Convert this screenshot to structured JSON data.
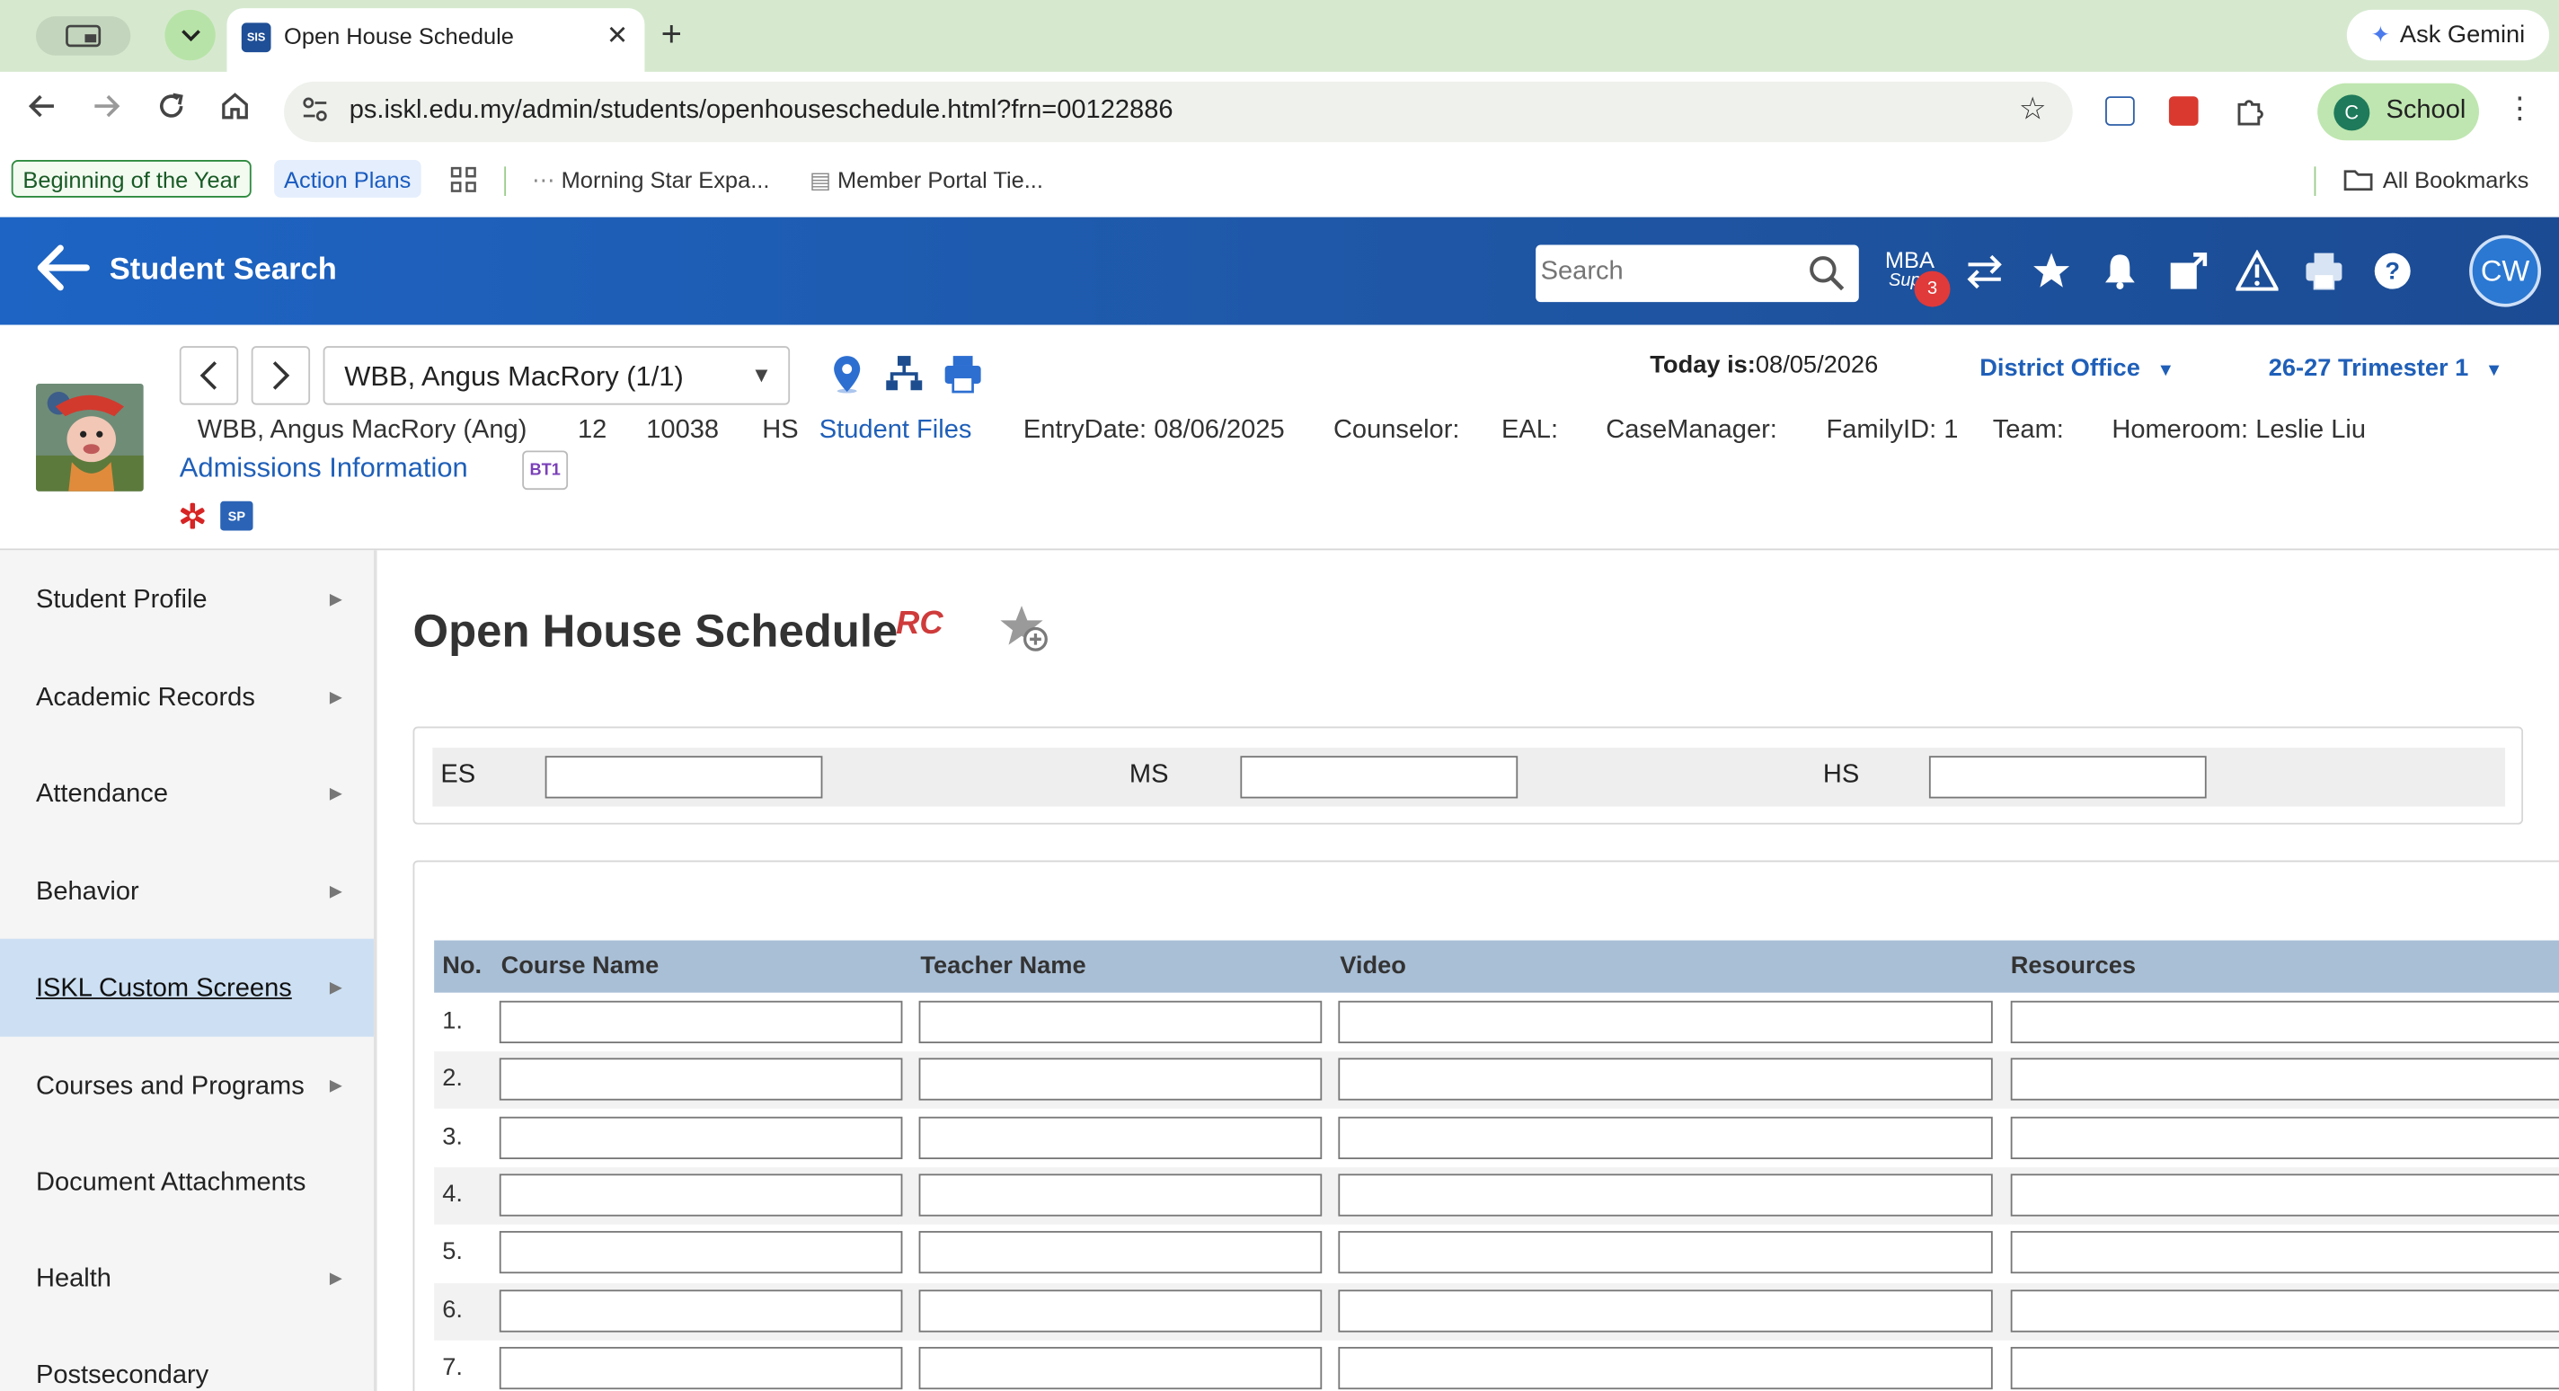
{
  "browser": {
    "tab_title": "Open House Schedule",
    "tab_favicon": "SIS",
    "ask_gemini": "Ask Gemini",
    "url": "ps.iskl.edu.my/admin/students/openhouseschedule.html?frn=00122886",
    "profile_initial": "C",
    "profile_name": "School",
    "bookmarks": [
      "Beginning of the Year",
      "Action Plans",
      "Morning Star Expa...",
      "Member Portal Tie..."
    ],
    "all_bookmarks": "All Bookmarks"
  },
  "header": {
    "back_label": "Student Search",
    "search_placeholder": "Search",
    "mba_line1": "MBA",
    "mba_line2": "Supp",
    "mba_badge": "3",
    "user_initials": "CW"
  },
  "student": {
    "selector": "WBB, Angus MacRory  (1/1)",
    "today_label": "Today is:",
    "today_value": "08/05/2026",
    "district": "District Office",
    "term": "26-27 Trimester 1",
    "name": "WBB, Angus MacRory (Ang)",
    "grade": "12",
    "id": "10038",
    "school": "HS",
    "files_link": "Student Files",
    "entry_date": "EntryDate: 08/06/2025",
    "counselor": "Counselor:",
    "eal": "EAL:",
    "case_manager": "CaseManager:",
    "family_id": "FamilyID: 1",
    "team": "Team:",
    "homeroom": "Homeroom: Leslie Liu",
    "admissions_link": "Admissions Information",
    "bt1": "BT1",
    "sp": "SP"
  },
  "sidebar": {
    "items": [
      {
        "label": "Student Profile",
        "arrow": true
      },
      {
        "label": "Academic Records",
        "arrow": true
      },
      {
        "label": "Attendance",
        "arrow": true
      },
      {
        "label": "Behavior",
        "arrow": true
      },
      {
        "label": "ISKL Custom Screens",
        "arrow": true,
        "active": true
      },
      {
        "label": "Courses and Programs",
        "arrow": true
      },
      {
        "label": "Document Attachments",
        "arrow": false
      },
      {
        "label": "Health",
        "arrow": true
      },
      {
        "label": "Postsecondary",
        "arrow": false
      }
    ]
  },
  "main": {
    "title": "Open House Schedule",
    "rc": "RC",
    "levels": [
      {
        "label": "ES",
        "value": ""
      },
      {
        "label": "MS",
        "value": ""
      },
      {
        "label": "HS",
        "value": ""
      }
    ],
    "columns": [
      "No.",
      "Course Name",
      "Teacher Name",
      "Video",
      "Resources"
    ],
    "rows": [
      "1.",
      "2.",
      "3.",
      "4.",
      "5.",
      "6.",
      "7."
    ]
  },
  "colors": {
    "header_blue": "#1f57a6",
    "link_blue": "#1f5fb8",
    "active_sidebar": "#cde0f3",
    "table_header": "#a9bfd6"
  },
  "icons": [
    "search-icon",
    "switch-icon",
    "star-icon",
    "bell-icon",
    "external-link-icon",
    "alert-icon",
    "print-icon",
    "help-icon",
    "location-pin-icon",
    "hierarchy-icon",
    "medical-icon",
    "favorite-star-icon"
  ]
}
